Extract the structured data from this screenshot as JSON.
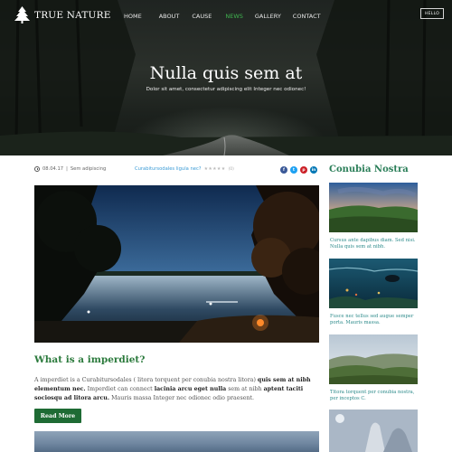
{
  "header": {
    "logo_text": "TRUE NATURE",
    "logo_icon": "pine-tree-icon",
    "nav": [
      {
        "label": "HOME",
        "active": false
      },
      {
        "label": "ABOUT",
        "active": false
      },
      {
        "label": "CAUSE",
        "active": false
      },
      {
        "label": "NEWS",
        "active": true
      },
      {
        "label": "GALLERY",
        "active": false
      },
      {
        "label": "CONTACT",
        "active": false
      }
    ],
    "cta_label": "HELLO"
  },
  "hero": {
    "title": "Nulla quis sem at",
    "subtitle": "Dolor sit amet, consectetur adipiscing elit Integer nec odionec!"
  },
  "post": {
    "date": "08.04.17",
    "category": "Sem adipiscing",
    "link_text": "Curabitursodales ligula nec?",
    "rating_stars": 5,
    "rating_count": "(0)",
    "social": [
      {
        "icon": "facebook-icon",
        "glyph": "f",
        "color": "#3b5998"
      },
      {
        "icon": "twitter-icon",
        "glyph": "t",
        "color": "#1da1f2"
      },
      {
        "icon": "pinterest-icon",
        "glyph": "p",
        "color": "#cb2027"
      },
      {
        "icon": "linkedin-icon",
        "glyph": "in",
        "color": "#0077b5"
      }
    ],
    "title": "What is a imperdiet?",
    "body": {
      "p1": "A imperdiet is a Curabitursodales ( litora torquent per conubia nostra litora) ",
      "b1": "quis sem at nibh elementum nec.",
      "p2": " Imperdiet can connect ",
      "b2": "lacinia arcu eget nulla",
      "p3": " sem at nibh ",
      "b3": "aptent taciti sociosqu ad litora arcu.",
      "p4": " Mauris massa Integer nec odionec odio praesent."
    },
    "read_more_label": "Read More"
  },
  "sidebar": {
    "title": "Conubia Nostra",
    "items": [
      {
        "caption": "Cursus ante dapibus diam. Sed nisi. Nulla quis sem at nibh."
      },
      {
        "caption": "Fusce nec tellus sed augue semper porta. Mauris massa."
      },
      {
        "caption": "Titora torquent per conubia nostra, per inceptos C."
      }
    ]
  },
  "colors": {
    "accent_green": "#2b7a3c",
    "nav_active": "#3fb34f",
    "button_green": "#1e6b34",
    "link_blue": "#3a9bd6",
    "caption_teal": "#2c8a8a"
  }
}
